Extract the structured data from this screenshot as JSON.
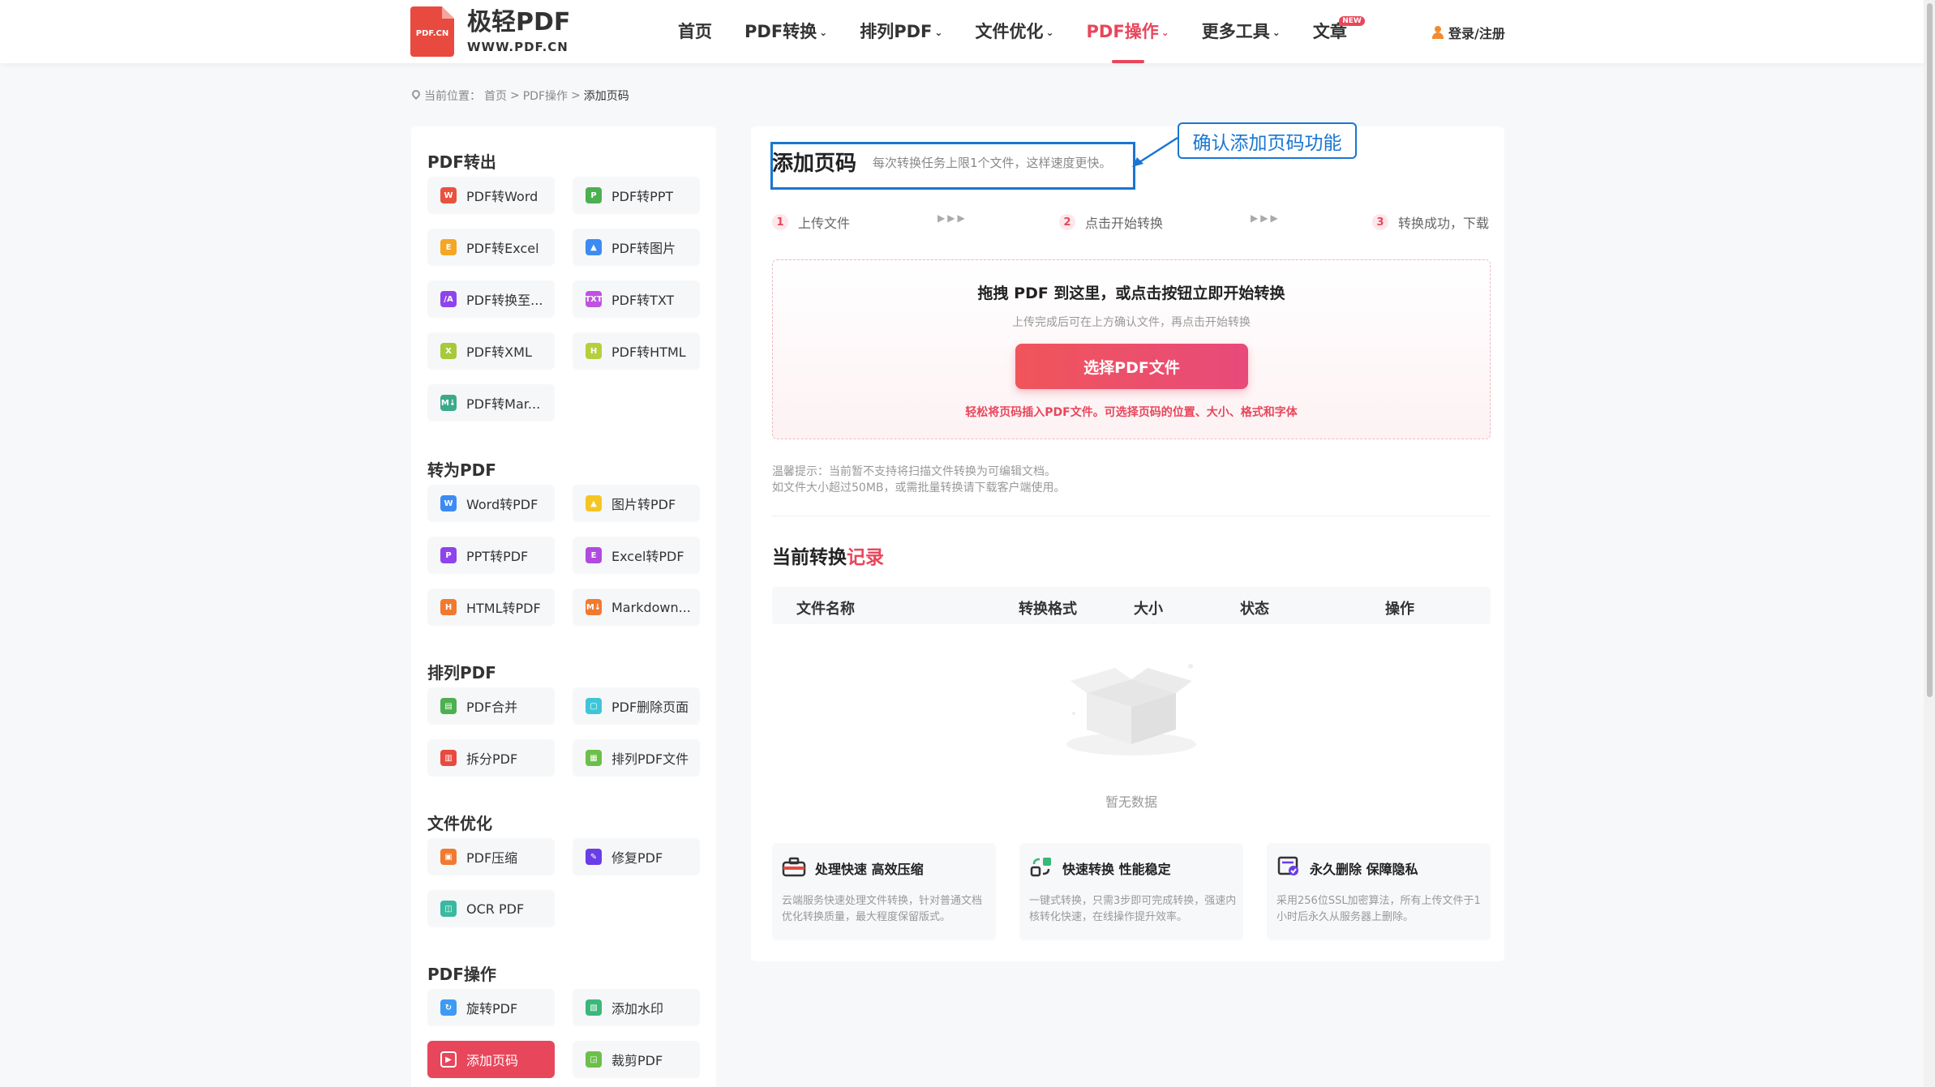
{
  "logo": {
    "icon_text": "PDF.CN",
    "title": "极轻PDF",
    "subtitle": "WWW.PDF.CN"
  },
  "nav": {
    "items": [
      {
        "label": "首页"
      },
      {
        "label": "PDF转换"
      },
      {
        "label": "排列PDF"
      },
      {
        "label": "文件优化"
      },
      {
        "label": "PDF操作"
      },
      {
        "label": "更多工具"
      },
      {
        "label": "文章"
      }
    ],
    "new_badge": "NEW",
    "login": "登录/注册"
  },
  "breadcrumb": {
    "prefix": "当前位置：",
    "home": "首页",
    "sep": ">",
    "parent": "PDF操作",
    "current": "添加页码"
  },
  "sidebar": {
    "sections": [
      {
        "title": "PDF转出",
        "items": [
          {
            "label": "PDF转Word",
            "icon": "W",
            "color": "#e8523f"
          },
          {
            "label": "PDF转PPT",
            "icon": "P",
            "color": "#4caf50"
          },
          {
            "label": "PDF转Excel",
            "icon": "E",
            "color": "#f5a623"
          },
          {
            "label": "PDF转图片",
            "icon": "▲",
            "color": "#3d8bf2"
          },
          {
            "label": "PDF转换至...",
            "icon": "/A",
            "color": "#8e44ec"
          },
          {
            "label": "PDF转TXT",
            "icon": "TXT",
            "color": "#c052e0"
          },
          {
            "label": "PDF转XML",
            "icon": "X",
            "color": "#a7c93a"
          },
          {
            "label": "PDF转HTML",
            "icon": "H",
            "color": "#b5cf3c"
          },
          {
            "label": "PDF转Mar...",
            "icon": "M↓",
            "color": "#3aaa8a"
          }
        ]
      },
      {
        "title": "转为PDF",
        "items": [
          {
            "label": "Word转PDF",
            "icon": "W",
            "color": "#3d8bf2"
          },
          {
            "label": "图片转PDF",
            "icon": "▲",
            "color": "#f5c623"
          },
          {
            "label": "PPT转PDF",
            "icon": "P",
            "color": "#8e44ec"
          },
          {
            "label": "Excel转PDF",
            "icon": "E",
            "color": "#b04be0"
          },
          {
            "label": "HTML转PDF",
            "icon": "H",
            "color": "#f07a30"
          },
          {
            "label": "Markdown...",
            "icon": "M↓",
            "color": "#f07a30"
          }
        ]
      },
      {
        "title": "排列PDF",
        "items": [
          {
            "label": "PDF合并",
            "icon": "▤",
            "color": "#4caf50"
          },
          {
            "label": "PDF删除页面",
            "icon": "▢",
            "color": "#3ec6d8"
          },
          {
            "label": "拆分PDF",
            "icon": "▥",
            "color": "#e84a3f"
          },
          {
            "label": "排列PDF文件",
            "icon": "▦",
            "color": "#6bbf4a"
          }
        ]
      },
      {
        "title": "文件优化",
        "items": [
          {
            "label": "PDF压缩",
            "icon": "▣",
            "color": "#f07a30"
          },
          {
            "label": "修复PDF",
            "icon": "✎",
            "color": "#6a3de8"
          },
          {
            "label": "OCR PDF",
            "icon": "◫",
            "color": "#3ab8a0"
          }
        ]
      },
      {
        "title": "PDF操作",
        "items": [
          {
            "label": "旋转PDF",
            "icon": "↻",
            "color": "#3d9bf2"
          },
          {
            "label": "添加水印",
            "icon": "▧",
            "color": "#3ab87a"
          },
          {
            "label": "添加页码",
            "icon": "▶",
            "color": "#e8465b"
          },
          {
            "label": "裁剪PDF",
            "icon": "◲",
            "color": "#6bbf4a"
          }
        ]
      }
    ]
  },
  "main": {
    "title": "添加页码",
    "desc": "每次转换任务上限1个文件，这样速度更快。",
    "callout": "确认添加页码功能",
    "steps": [
      {
        "num": "1",
        "label": "上传文件"
      },
      {
        "num": "2",
        "label": "点击开始转换"
      },
      {
        "num": "3",
        "label": "转换成功，下载"
      }
    ],
    "step_sep": "▶▶▶",
    "upload": {
      "title": "拖拽 PDF 到这里，或点击按钮立即开始转换",
      "subtitle": "上传完成后可在上方确认文件，再点击开始转换",
      "button": "选择PDF文件",
      "note": "轻松将页码插入PDF文件。可选择页码的位置、大小、格式和字体"
    },
    "tips": {
      "line1": "温馨提示：当前暂不支持将扫描文件转换为可编辑文档。",
      "line2": "如文件大小超过50MB，或需批量转换请下载客户端使用。"
    },
    "records": {
      "title_a": "当前转换",
      "title_b": "记录",
      "columns": [
        "文件名称",
        "转换格式",
        "大小",
        "状态",
        "操作"
      ],
      "empty": "暂无数据"
    },
    "features": [
      {
        "title": "处理快速 高效压缩",
        "desc": "云端服务快速处理文件转换，针对普通文档优化转换质量，最大程度保留版式。"
      },
      {
        "title": "快速转换 性能稳定",
        "desc": "一键式转换，只需3步即可完成转换，强速内核转化快速，在线操作提升效率。"
      },
      {
        "title": "永久删除 保障隐私",
        "desc": "采用256位SSL加密算法，所有上传文件于1小时后永久从服务器上删除。"
      }
    ]
  }
}
